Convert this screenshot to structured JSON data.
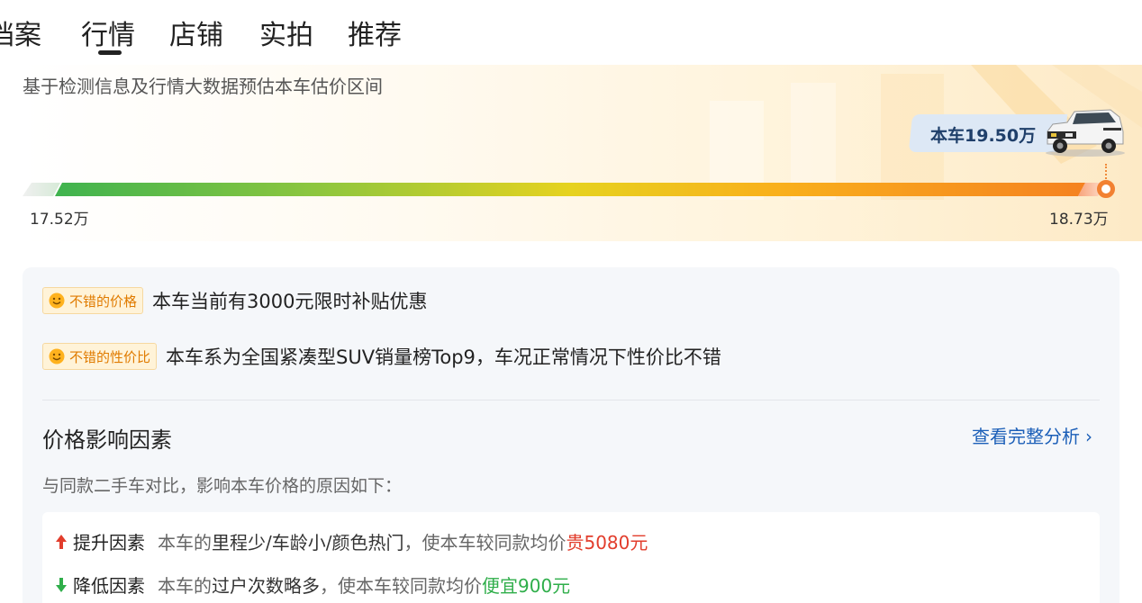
{
  "tabs": [
    {
      "label": "档案"
    },
    {
      "label": "行情"
    },
    {
      "label": "店铺"
    },
    {
      "label": "实拍"
    },
    {
      "label": "推荐"
    }
  ],
  "active_tab": "行情",
  "estimate": {
    "subtitle": "基于检测信息及行情大数据预估本车估价区间",
    "car_price_label": "本车19.50万",
    "low": "17.52万",
    "high": "18.73万"
  },
  "reasons": [
    {
      "badge": "不错的价格",
      "text": "本车当前有3000元限时补贴优惠"
    },
    {
      "badge": "不错的性价比",
      "text": "本车系为全国紧凑型SUV销量榜Top9，车况正常情况下性价比不错"
    }
  ],
  "factors": {
    "title": "价格影响因素",
    "link": "查看完整分析",
    "subtitle": "与同款二手车对比，影响本车价格的原因如下：",
    "up": {
      "label": "提升因素",
      "pre": "本车的",
      "items": "里程少/车龄小/颜色热门",
      "mid": "，使本车较同款均价",
      "value": "贵5080元"
    },
    "down": {
      "label": "降低因素",
      "pre": "本车的",
      "items": "过户次数略多",
      "mid": "，使本车较同款均价",
      "value": "便宜900元"
    }
  },
  "colors": {
    "accent_orange": "#f28132",
    "link_blue": "#1c5fb8",
    "up_red": "#e23d2c",
    "down_green": "#2fae4a"
  },
  "icons": [
    "smile-icon",
    "arrow-up-icon",
    "arrow-down-icon",
    "chevron-right-icon",
    "car-image"
  ]
}
